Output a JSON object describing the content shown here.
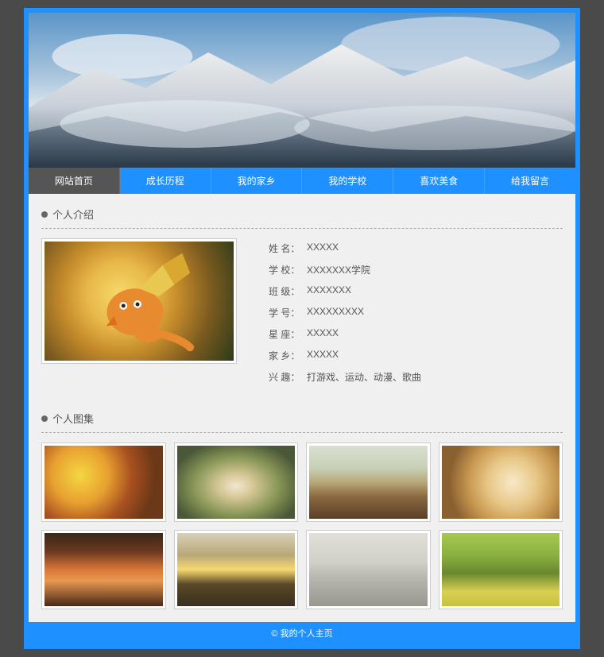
{
  "nav": {
    "items": [
      {
        "label": "网站首页",
        "active": true
      },
      {
        "label": "成长历程",
        "active": false
      },
      {
        "label": "我的家乡",
        "active": false
      },
      {
        "label": "我的学校",
        "active": false
      },
      {
        "label": "喜欢美食",
        "active": false
      },
      {
        "label": "给我留言",
        "active": false
      }
    ]
  },
  "sections": {
    "intro_title": "个人介绍",
    "gallery_title": "个人图集"
  },
  "profile": {
    "rows": [
      {
        "label": "姓 名：",
        "value": "XXXXX"
      },
      {
        "label": "学 校：",
        "value": "XXXXXXX学院"
      },
      {
        "label": "班 级：",
        "value": "XXXXXXX"
      },
      {
        "label": "学 号：",
        "value": "XXXXXXXXX"
      },
      {
        "label": "星 座：",
        "value": "XXXXX"
      },
      {
        "label": "家 乡：",
        "value": "XXXXX"
      },
      {
        "label": "兴 趣：",
        "value": "打游戏、运动、动漫、歌曲"
      }
    ]
  },
  "gallery": {
    "items": [
      {
        "name": "food-1"
      },
      {
        "name": "food-2"
      },
      {
        "name": "food-3"
      },
      {
        "name": "food-4"
      },
      {
        "name": "scene-sunset"
      },
      {
        "name": "scene-willow"
      },
      {
        "name": "scene-snow"
      },
      {
        "name": "scene-park"
      }
    ]
  },
  "footer": {
    "text": "© 我的个人主页"
  }
}
